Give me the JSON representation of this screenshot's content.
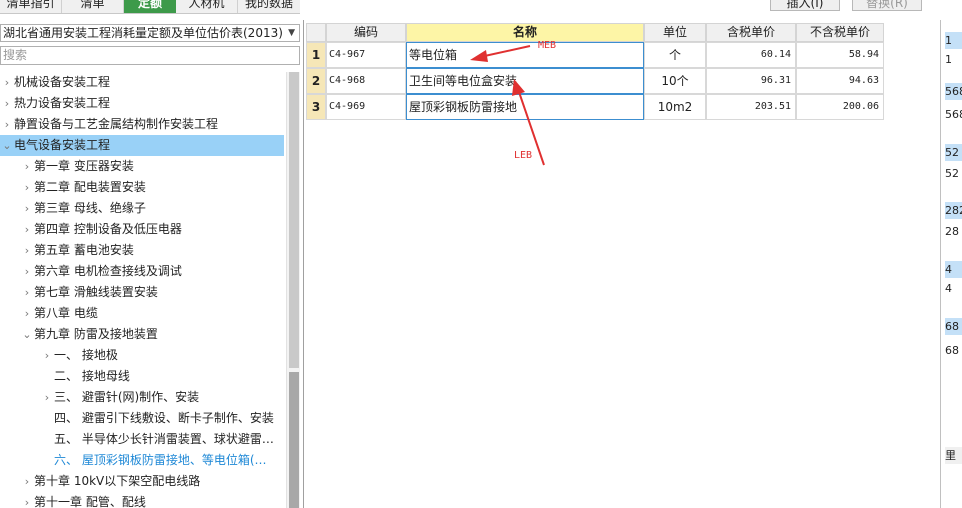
{
  "tabs": [
    "清单指引",
    "清单",
    "定额",
    "人材机",
    "我的数据"
  ],
  "top_buttons": [
    "插入(I)",
    "替换(R)"
  ],
  "database": "湖北省通用安装工程消耗量定额及单位估价表(2013)",
  "search_placeholder": "搜索",
  "tree": [
    {
      "label": "机械设备安装工程",
      "chev": "›",
      "indent": 0
    },
    {
      "label": "热力设备安装工程",
      "chev": "›",
      "indent": 0
    },
    {
      "label": "静置设备与工艺金属结构制作安装工程",
      "chev": "›",
      "indent": 0
    },
    {
      "label": "电气设备安装工程",
      "chev": "⌄",
      "indent": 0,
      "selected": true
    },
    {
      "label": "第一章 变压器安装",
      "chev": "›",
      "indent": 1
    },
    {
      "label": "第二章 配电装置安装",
      "chev": "›",
      "indent": 1
    },
    {
      "label": "第三章 母线、绝缘子",
      "chev": "›",
      "indent": 1
    },
    {
      "label": "第四章 控制设备及低压电器",
      "chev": "›",
      "indent": 1
    },
    {
      "label": "第五章 蓄电池安装",
      "chev": "›",
      "indent": 1
    },
    {
      "label": "第六章 电机检查接线及调试",
      "chev": "›",
      "indent": 1
    },
    {
      "label": "第七章 滑触线装置安装",
      "chev": "›",
      "indent": 1
    },
    {
      "label": "第八章 电缆",
      "chev": "›",
      "indent": 1
    },
    {
      "label": "第九章 防雷及接地装置",
      "chev": "⌄",
      "indent": 1
    },
    {
      "label": "一、 接地极",
      "chev": "›",
      "indent": 2
    },
    {
      "label": "二、 接地母线",
      "chev": "",
      "indent": 2
    },
    {
      "label": "三、 避雷针(网)制作、安装",
      "chev": "›",
      "indent": 2
    },
    {
      "label": "四、 避雷引下线敷设、断卡子制作、安装",
      "chev": "",
      "indent": 2
    },
    {
      "label": "五、 半导体少长针消雷装置、球状避雷…",
      "chev": "",
      "indent": 2
    },
    {
      "label": "六、 屋顶彩钢板防雷接地、等电位箱(…",
      "chev": "",
      "indent": 2,
      "current": true
    },
    {
      "label": "第十章 10kV以下架空配电线路",
      "chev": "›",
      "indent": 1
    },
    {
      "label": "第十一章 配管、配线",
      "chev": "›",
      "indent": 1
    }
  ],
  "grid": {
    "headers": [
      "",
      "编码",
      "名称",
      "单位",
      "含税单价",
      "不含税单价"
    ],
    "rows": [
      {
        "no": "1",
        "code": "C4-967",
        "name": "等电位箱",
        "unit": "个",
        "price_tax": "60.14",
        "price_notax": "58.94"
      },
      {
        "no": "2",
        "code": "C4-968",
        "name": "卫生间等电位盒安装",
        "unit": "10个",
        "price_tax": "96.31",
        "price_notax": "94.63"
      },
      {
        "no": "3",
        "code": "C4-969",
        "name": "屋顶彩钢板防雷接地",
        "unit": "10m2",
        "price_tax": "203.51",
        "price_notax": "200.06"
      }
    ]
  },
  "annotations": {
    "meb": "MEB",
    "leb": "LEB",
    "color": "#e03030"
  },
  "right_panel": [
    "1",
    "1",
    "568",
    "568",
    "52",
    "52",
    "282",
    "28",
    "4",
    "4",
    "68",
    "68",
    "里"
  ]
}
